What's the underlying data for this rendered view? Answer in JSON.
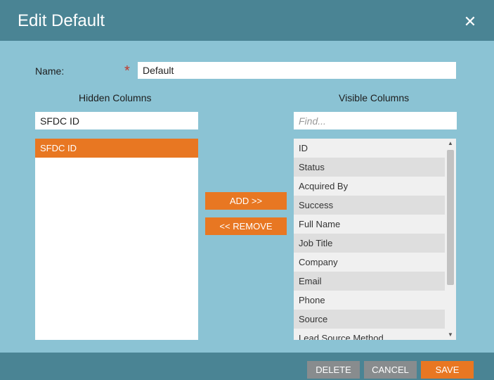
{
  "dialog": {
    "title": "Edit Default",
    "close_icon": "close-icon"
  },
  "name_field": {
    "label": "Name:",
    "required_marker": "*",
    "value": "Default"
  },
  "hidden_columns": {
    "header": "Hidden Columns",
    "filter_value": "SFDC ID",
    "items": [
      "SFDC ID"
    ],
    "selected_index": 0
  },
  "visible_columns": {
    "header": "Visible Columns",
    "filter_placeholder": "Find...",
    "items": [
      "ID",
      "Status",
      "Acquired By",
      "Success",
      "Full Name",
      "Job Title",
      "Company",
      "Email",
      "Phone",
      "Source",
      "Lead Source Method"
    ]
  },
  "actions": {
    "add_label": "ADD >>",
    "remove_label": "<< REMOVE"
  },
  "footer": {
    "delete_label": "DELETE",
    "cancel_label": "CANCEL",
    "save_label": "SAVE"
  },
  "colors": {
    "titlebar": "#4a8494",
    "body": "#8bc3d4",
    "accent": "#e87722",
    "gray_button": "#888c8e"
  }
}
